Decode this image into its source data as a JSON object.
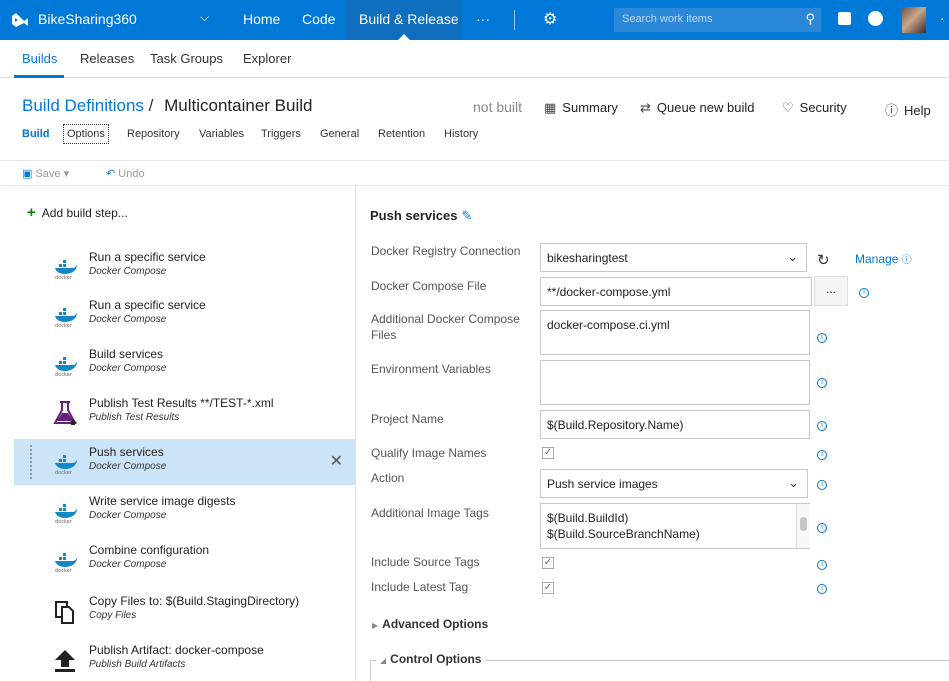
{
  "app": {
    "project": "BikeSharing360",
    "nav": [
      "Home",
      "Code",
      "Build & Release",
      "···"
    ],
    "search_placeholder": "Search work items"
  },
  "subnav": [
    "Builds",
    "Releases",
    "Task Groups",
    "Explorer"
  ],
  "header": {
    "breadcrumb_link": "Build Definitions",
    "breadcrumb_sep": "/",
    "title": "Multicontainer Build",
    "status": "not built",
    "summary": "Summary",
    "queue": "Queue new build",
    "security": "Security",
    "help": "Help"
  },
  "tabs": [
    "Build",
    "Options",
    "Repository",
    "Variables",
    "Triggers",
    "General",
    "Retention",
    "History"
  ],
  "toolbar": {
    "save": "Save",
    "undo": "Undo"
  },
  "add_step": "Add build step...",
  "steps": [
    {
      "title": "Run a specific service",
      "subtitle": "Docker Compose",
      "icon": "docker-icon"
    },
    {
      "title": "Run a specific service",
      "subtitle": "Docker Compose",
      "icon": "docker-icon"
    },
    {
      "title": "Build services",
      "subtitle": "Docker Compose",
      "icon": "docker-icon"
    },
    {
      "title": "Publish Test Results **/TEST-*.xml",
      "subtitle": "Publish Test Results",
      "icon": "flask-icon"
    },
    {
      "title": "Push services",
      "subtitle": "Docker Compose",
      "icon": "docker-icon"
    },
    {
      "title": "Write service image digests",
      "subtitle": "Docker Compose",
      "icon": "docker-icon"
    },
    {
      "title": "Combine configuration",
      "subtitle": "Docker Compose",
      "icon": "docker-icon"
    },
    {
      "title": "Copy Files to: $(Build.StagingDirectory)",
      "subtitle": "Copy Files",
      "icon": "copy-icon"
    },
    {
      "title": "Publish Artifact: docker-compose",
      "subtitle": "Publish Build Artifacts",
      "icon": "upload-icon"
    }
  ],
  "task": {
    "title": "Push services",
    "labels": {
      "registry": "Docker Registry Connection",
      "compose_file": "Docker Compose File",
      "additional_compose": "Additional Docker Compose Files",
      "env_vars": "Environment Variables",
      "project_name": "Project Name",
      "qualify": "Qualify Image Names",
      "action": "Action",
      "image_tags": "Additional Image Tags",
      "source_tags": "Include Source Tags",
      "latest_tag": "Include Latest Tag"
    },
    "values": {
      "registry": "bikesharingtest",
      "compose_file": "**/docker-compose.yml",
      "additional_compose": "docker-compose.ci.yml",
      "env_vars": "",
      "project_name": "$(Build.Repository.Name)",
      "action": "Push service images",
      "image_tag_1": "$(Build.BuildId)",
      "image_tag_2": "$(Build.SourceBranchName)"
    },
    "manage": "Manage",
    "browse": "...",
    "advanced": "Advanced Options",
    "control": "Control Options"
  },
  "colors": {
    "accent": "#0078d7",
    "topbar": "#0078d7",
    "selected": "#cce4f7"
  }
}
